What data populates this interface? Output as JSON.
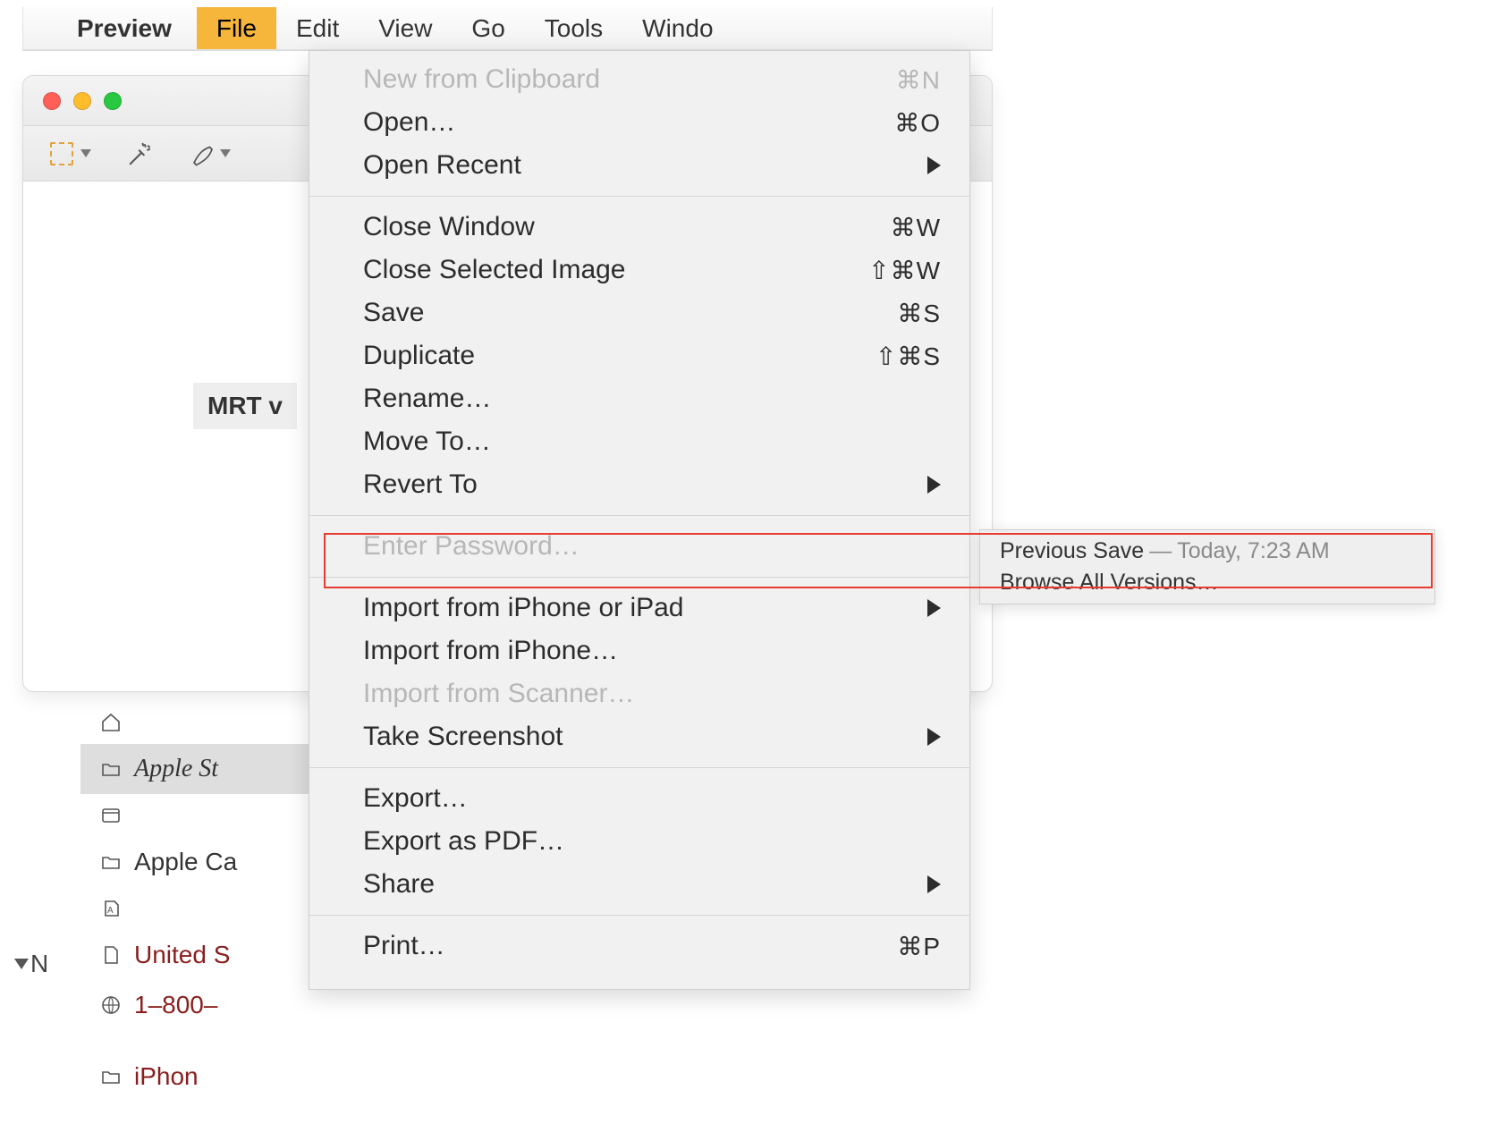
{
  "menubar": {
    "app_name": "Preview",
    "items": [
      "File",
      "Edit",
      "View",
      "Go",
      "Tools",
      "Windo"
    ]
  },
  "window": {
    "mrt_label": "MRT v"
  },
  "file_menu": {
    "new_from_clipboard": "New from Clipboard",
    "open": "Open…",
    "open_recent": "Open Recent",
    "close_window": "Close Window",
    "close_selected_image": "Close Selected Image",
    "save": "Save",
    "duplicate": "Duplicate",
    "rename": "Rename…",
    "move_to": "Move To…",
    "revert_to": "Revert To",
    "enter_password": "Enter Password…",
    "import_iphone_ipad": "Import from iPhone or iPad",
    "import_iphone": "Import from iPhone…",
    "import_scanner": "Import from Scanner…",
    "take_screenshot": "Take Screenshot",
    "export": "Export…",
    "export_pdf": "Export as PDF…",
    "share": "Share",
    "print": "Print…",
    "sc_new": "⌘N",
    "sc_open": "⌘O",
    "sc_close_window": "⌘W",
    "sc_close_selected": "⇧⌘W",
    "sc_save": "⌘S",
    "sc_duplicate": "⇧⌘S",
    "sc_print": "⌘P"
  },
  "submenu": {
    "previous_save": "Previous Save",
    "dash": " — ",
    "timestamp": "Today, 7:23 AM",
    "browse_all": "Browse All Versions…"
  },
  "bg": {
    "apple_store": "Apple St",
    "apple_ca": "Apple Ca",
    "us": "United S",
    "phone": "1–800–",
    "iphon": "iPhon",
    "note_letter": "N"
  }
}
